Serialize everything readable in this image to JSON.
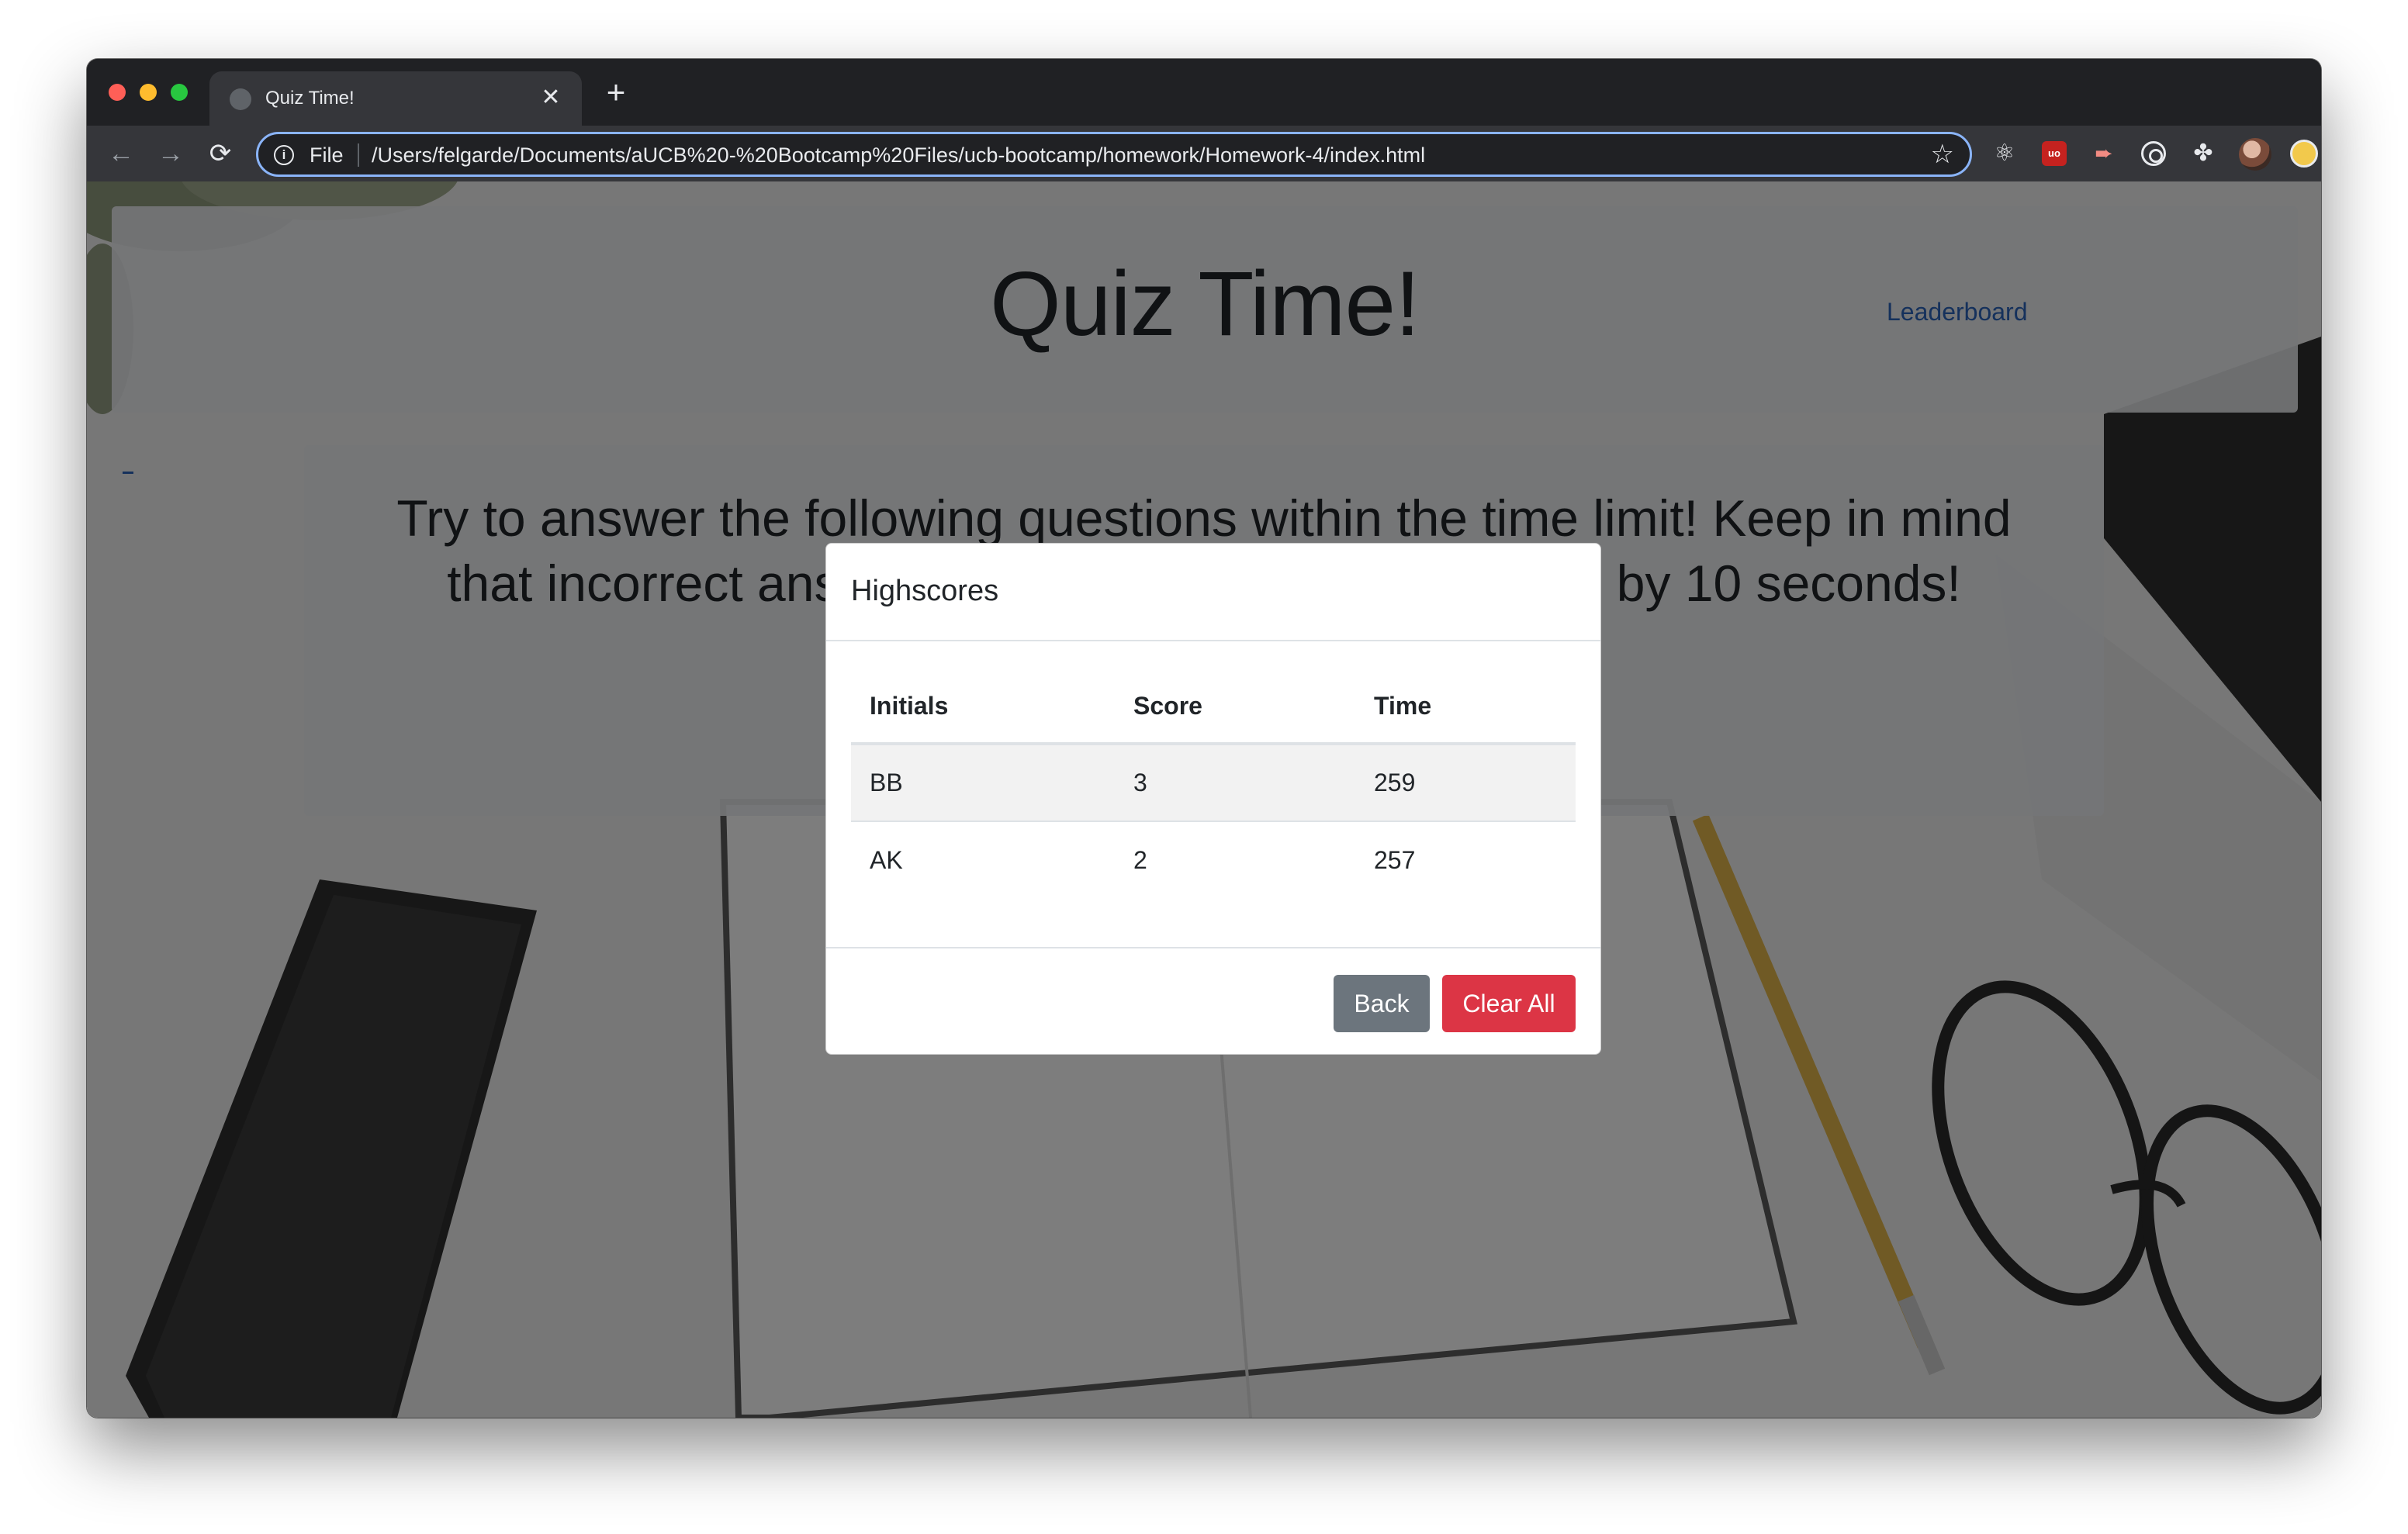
{
  "browser": {
    "tab_title": "Quiz Time!",
    "tab_close": "✕",
    "new_tab": "+",
    "nav": {
      "back": "←",
      "forward": "→",
      "reload": "⟳"
    },
    "omnibox": {
      "info_glyph": "i",
      "scheme": "File",
      "url": "/Users/felgarde/Documents/aUCB%20-%20Bootcamp%20Files/ucb-bootcamp/homework/Homework-4/index.html",
      "star": "☆"
    },
    "extensions": {
      "react": "⚛",
      "ublock": "uo",
      "video": "➨",
      "puzzle": "✤"
    }
  },
  "page": {
    "title": "Quiz Time!",
    "leaderboard_link": "Leaderboard",
    "intro_text": "Try to answer the following questions within the time limit! Keep in mind that incorrect answers will penalize your score/time by 10 seconds! Click"
  },
  "modal": {
    "title": "Highscores",
    "columns": [
      "Initials",
      "Score",
      "Time"
    ],
    "rows": [
      [
        "BB",
        "3",
        "259"
      ],
      [
        "AK",
        "2",
        "257"
      ]
    ],
    "back_label": "Back",
    "clear_label": "Clear All"
  },
  "colors": {
    "accent": "#8ab4f8",
    "link": "#2b62b8",
    "back_button": "#6c757d",
    "clear_button": "#dc3545"
  }
}
